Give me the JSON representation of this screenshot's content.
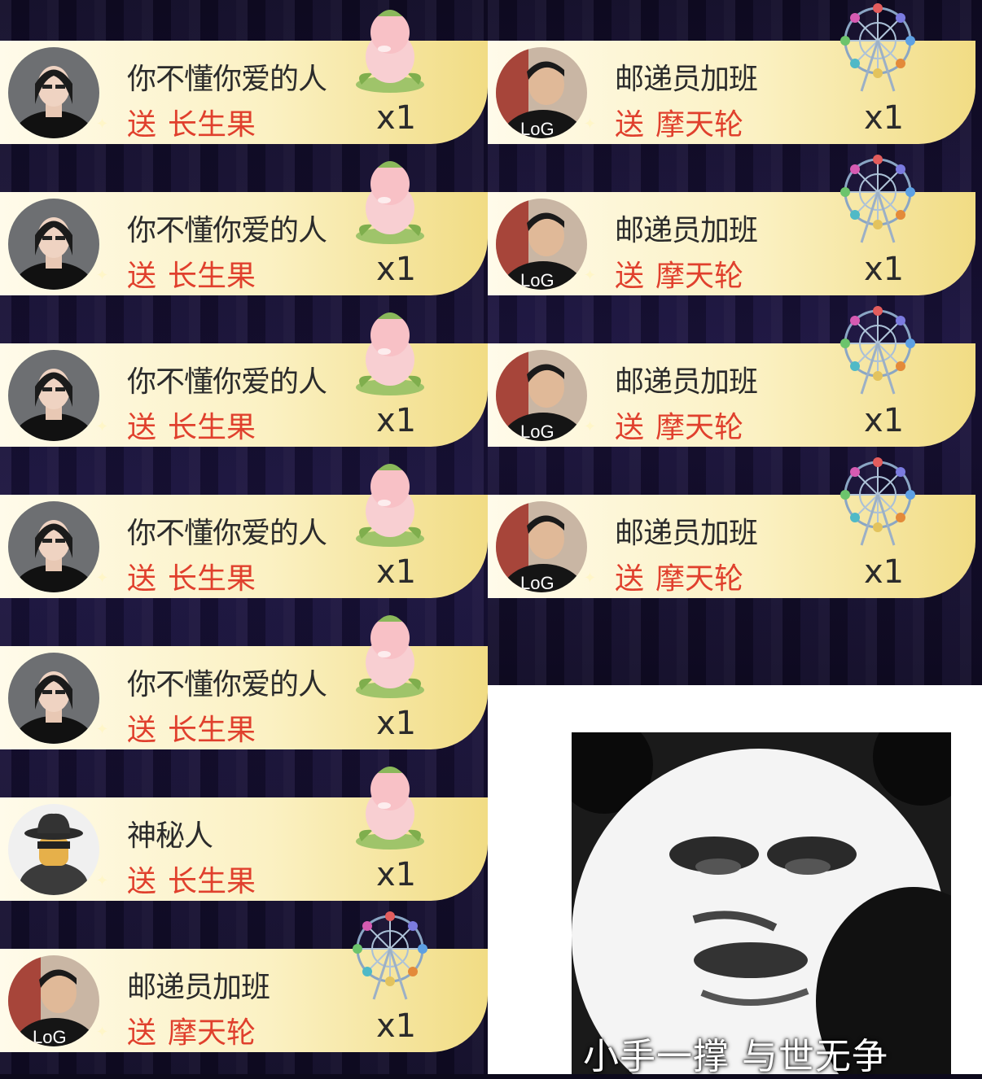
{
  "left_feed": [
    {
      "sender": "你不懂你爱的人",
      "action": "送",
      "gift": "长生果",
      "count": "x1",
      "avatar": "woman-avatar",
      "gift_icon": "peach-icon"
    },
    {
      "sender": "你不懂你爱的人",
      "action": "送",
      "gift": "长生果",
      "count": "x1",
      "avatar": "woman-avatar",
      "gift_icon": "peach-icon"
    },
    {
      "sender": "你不懂你爱的人",
      "action": "送",
      "gift": "长生果",
      "count": "x1",
      "avatar": "woman-avatar",
      "gift_icon": "peach-icon"
    },
    {
      "sender": "你不懂你爱的人",
      "action": "送",
      "gift": "长生果",
      "count": "x1",
      "avatar": "woman-avatar",
      "gift_icon": "peach-icon"
    },
    {
      "sender": "你不懂你爱的人",
      "action": "送",
      "gift": "长生果",
      "count": "x1",
      "avatar": "woman-avatar",
      "gift_icon": "peach-icon"
    },
    {
      "sender": "神秘人",
      "action": "送",
      "gift": "长生果",
      "count": "x1",
      "avatar": "mystery-avatar",
      "gift_icon": "peach-icon"
    },
    {
      "sender": "邮递员加班",
      "action": "送",
      "gift": "摩天轮",
      "count": "x1",
      "avatar": "man-avatar",
      "gift_icon": "ferris-wheel-icon"
    }
  ],
  "right_feed": [
    {
      "sender": "邮递员加班",
      "action": "送",
      "gift": "摩天轮",
      "count": "x1",
      "avatar": "man-avatar",
      "gift_icon": "ferris-wheel-icon"
    },
    {
      "sender": "邮递员加班",
      "action": "送",
      "gift": "摩天轮",
      "count": "x1",
      "avatar": "man-avatar",
      "gift_icon": "ferris-wheel-icon"
    },
    {
      "sender": "邮递员加班",
      "action": "送",
      "gift": "摩天轮",
      "count": "x1",
      "avatar": "man-avatar",
      "gift_icon": "ferris-wheel-icon"
    },
    {
      "sender": "邮递员加班",
      "action": "送",
      "gift": "摩天轮",
      "count": "x1",
      "avatar": "man-avatar",
      "gift_icon": "ferris-wheel-icon"
    }
  ],
  "meme": {
    "caption": "小手一撑 与世无争",
    "image": "panda-face-meme"
  },
  "colors": {
    "sender_text": "#2b2b2b",
    "gift_text": "#e0402d",
    "banner_gold": "#f1dc84",
    "background": "#120d29"
  }
}
